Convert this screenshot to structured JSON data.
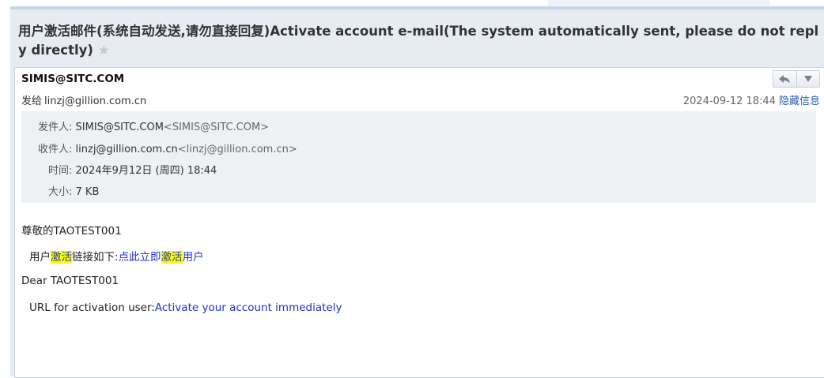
{
  "email": {
    "subject": "用户激活邮件(系统自动发送,请勿直接回复)Activate account e-mail(The system automatically sent, please do not reply directly)",
    "star_icon": "star-icon",
    "sender_name": "SIMIS@SITC.COM",
    "to_prefix": "发给",
    "to_address": "linzj@gillion.com.cn",
    "datetime": "2024-09-12 18:44",
    "hide_info_label": "隐藏信息",
    "buttons": {
      "reply_icon": "reply-icon",
      "more_icon": "dropdown-icon"
    },
    "details": {
      "from_label": "发件人:",
      "from_value": "SIMIS@SITC.COM",
      "from_bracket": "<SIMIS@SITC.COM>",
      "to_label": "收件人:",
      "to_value": "linzj@gillion.com.cn",
      "to_bracket": "<linzj@gillion.com.cn>",
      "time_label": "时间:",
      "time_value": "2024年9月12日 (周四) 18:44",
      "size_label": "大小:",
      "size_value": "7 KB"
    },
    "body": {
      "greeting_cn": "尊敬的TAOTEST001",
      "line_cn_prefix": "用户",
      "line_cn_highlight": "激活",
      "line_cn_mid": "链接如下:",
      "link_cn_part1": "点此立即",
      "link_cn_highlight": "激活",
      "link_cn_part2": "用户",
      "greeting_en": "Dear TAOTEST001",
      "line_en_prefix": "URL for activation user:",
      "link_en": "Activate your account immediately"
    }
  }
}
